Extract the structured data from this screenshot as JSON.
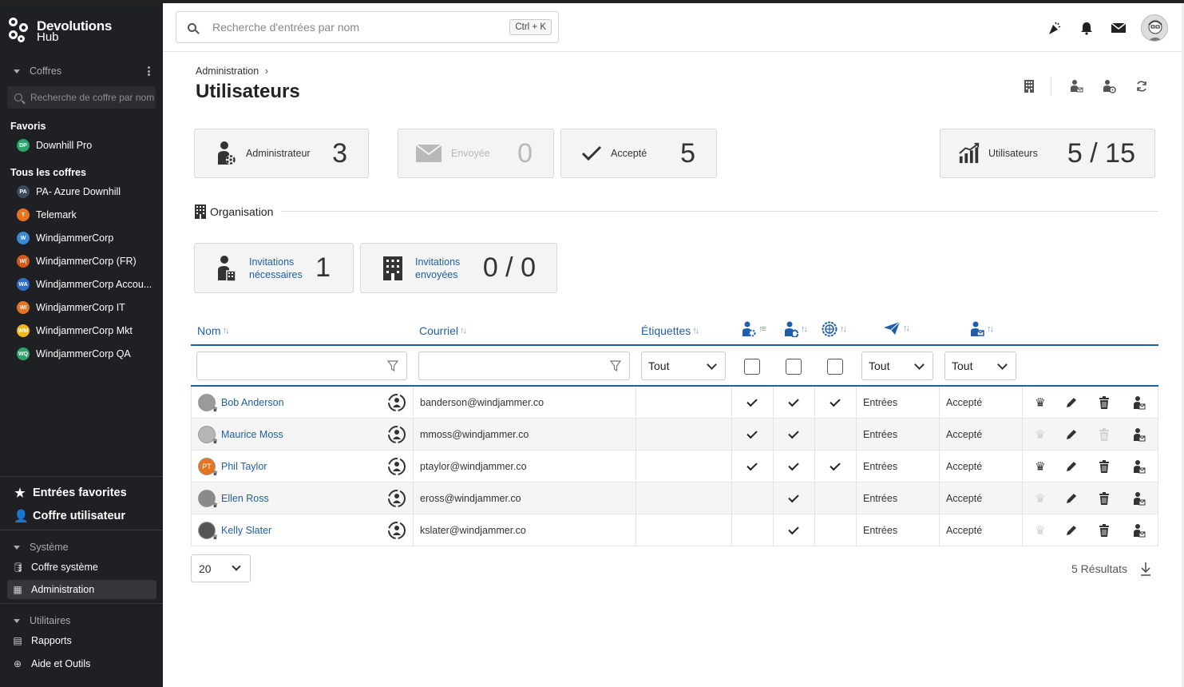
{
  "sidebar": {
    "logo_line1": "Devolutions",
    "logo_line2": "Hub",
    "vaults_section": "Coffres",
    "vault_search_placeholder": "Recherche de coffre par nom",
    "favorites_title": "Favoris",
    "favorites": [
      {
        "initials": "DP",
        "label": "Downhill Pro",
        "color": "#2ea36b"
      }
    ],
    "all_vaults_title": "Tous les coffres",
    "vaults": [
      {
        "initials": "PA",
        "label": "PA- Azure Downhill",
        "color": "#3c4a5e"
      },
      {
        "initials": "T",
        "label": "Telemark",
        "color": "#e8731f"
      },
      {
        "initials": "W",
        "label": "WindjammerCorp",
        "color": "#3a8ad6"
      },
      {
        "initials": "W(",
        "label": "WindjammerCorp (FR)",
        "color": "#d4581a"
      },
      {
        "initials": "WA",
        "label": "WindjammerCorp Accou...",
        "color": "#2f6fc2"
      },
      {
        "initials": "WI",
        "label": "WindjammerCorp IT",
        "color": "#e8731f"
      },
      {
        "initials": "WM",
        "label": "WindjammerCorp Mkt",
        "color": "#f0b81a"
      },
      {
        "initials": "WQ",
        "label": "WindjammerCorp QA",
        "color": "#2ea36b"
      }
    ],
    "favorite_entries": "Entrées favorites",
    "user_vault": "Coffre utilisateur",
    "system_section": "Système",
    "system_vault": "Coffre système",
    "administration": "Administration",
    "utilities_section": "Utilitaires",
    "reports": "Rapports",
    "help_tools": "Aide et Outils"
  },
  "topbar": {
    "search_placeholder": "Recherche d'entrées par nom",
    "shortcut": "Ctrl + K"
  },
  "page": {
    "breadcrumb": "Administration",
    "title": "Utilisateurs"
  },
  "stats": {
    "admin_label": "Administrateur",
    "admin_value": "3",
    "sent_label": "Envoyée",
    "sent_value": "0",
    "accepted_label": "Accepté",
    "accepted_value": "5",
    "users_label": "Utilisateurs",
    "users_value": "5 / 15"
  },
  "organisation": {
    "title": "Organisation",
    "invites_needed_line1": "Invitations",
    "invites_needed_line2": "nécessaires",
    "invites_needed_value": "1",
    "invites_sent_line1": "Invitations",
    "invites_sent_line2": "envoyées",
    "invites_sent_value": "0 / 0"
  },
  "table": {
    "col_name": "Nom",
    "col_email": "Courriel",
    "col_tags": "Étiquettes",
    "filter_tags": "Tout",
    "filter_invite": "Tout",
    "filter_status": "Tout",
    "rows": [
      {
        "name": "Bob Anderson",
        "email": "banderson@windjammer.co",
        "admin": true,
        "c2": true,
        "c3": true,
        "access": "Entrées",
        "status": "Accepté",
        "crown_active": true,
        "delete_active": true,
        "avatar_color": "#9a9a9a",
        "avatar_text": ""
      },
      {
        "name": "Maurice Moss",
        "email": "mmoss@windjammer.co",
        "admin": true,
        "c2": true,
        "c3": false,
        "access": "Entrées",
        "status": "Accepté",
        "crown_active": false,
        "delete_active": false,
        "avatar_color": "#b5b5b5",
        "avatar_text": ""
      },
      {
        "name": "Phil Taylor",
        "email": "ptaylor@windjammer.co",
        "admin": true,
        "c2": true,
        "c3": true,
        "access": "Entrées",
        "status": "Accepté",
        "crown_active": true,
        "delete_active": true,
        "avatar_color": "#e8731f",
        "avatar_text": "PT"
      },
      {
        "name": "Ellen Ross",
        "email": "eross@windjammer.co",
        "admin": false,
        "c2": true,
        "c3": false,
        "access": "Entrées",
        "status": "Accepté",
        "crown_active": false,
        "delete_active": true,
        "avatar_color": "#8a8a8a",
        "avatar_text": ""
      },
      {
        "name": "Kelly Slater",
        "email": "kslater@windjammer.co",
        "admin": false,
        "c2": true,
        "c3": false,
        "access": "Entrées",
        "status": "Accepté",
        "crown_active": false,
        "delete_active": true,
        "avatar_color": "#555555",
        "avatar_text": ""
      }
    ]
  },
  "footer": {
    "page_size": "20",
    "results": "5 Résultats"
  }
}
